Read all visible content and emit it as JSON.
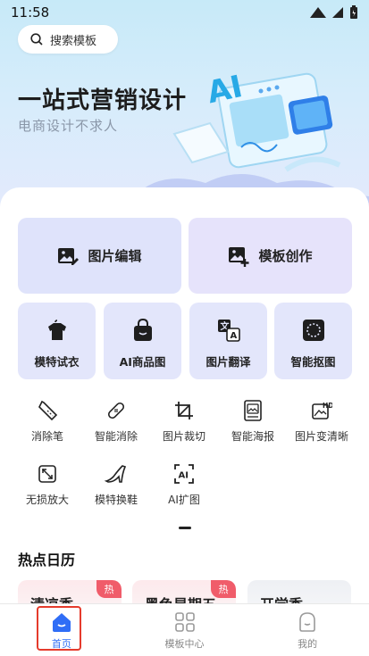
{
  "status": {
    "time": "11:58"
  },
  "search": {
    "placeholder": "搜索模板"
  },
  "hero": {
    "title": "一站式营销设计",
    "subtitle": "电商设计不求人"
  },
  "primary_actions": [
    {
      "label": "图片编辑",
      "icon": "image-edit-icon"
    },
    {
      "label": "模板创作",
      "icon": "template-create-icon"
    }
  ],
  "feature_cards": [
    {
      "label": "模特试衣",
      "icon": "tshirt-icon"
    },
    {
      "label": "AI商品图",
      "icon": "shopping-bag-icon"
    },
    {
      "label": "图片翻译",
      "icon": "translate-icon"
    },
    {
      "label": "智能抠图",
      "icon": "cutout-icon"
    }
  ],
  "tools": [
    {
      "label": "消除笔",
      "icon": "eraser-pen-icon"
    },
    {
      "label": "智能消除",
      "icon": "bandage-icon"
    },
    {
      "label": "图片裁切",
      "icon": "crop-icon"
    },
    {
      "label": "智能海报",
      "icon": "poster-icon"
    },
    {
      "label": "图片变清晰",
      "icon": "hd-image-icon"
    },
    {
      "label": "无损放大",
      "icon": "upscale-icon"
    },
    {
      "label": "模特换鞋",
      "icon": "high-heel-icon"
    },
    {
      "label": "AI扩图",
      "icon": "ai-expand-icon"
    }
  ],
  "calendar": {
    "title": "热点日历",
    "cards": [
      {
        "name": "清凉季",
        "badge": "热"
      },
      {
        "name": "黑色星期五",
        "badge": "热"
      },
      {
        "name": "开学季",
        "badge": ""
      }
    ]
  },
  "tabbar": [
    {
      "label": "首页",
      "icon": "home-icon",
      "active": true
    },
    {
      "label": "模板中心",
      "icon": "grid-icon",
      "active": false
    },
    {
      "label": "我的",
      "icon": "profile-icon",
      "active": false
    }
  ],
  "colors": {
    "accent": "#2f6df6",
    "hot_badge": "#f05c6a",
    "highlight": "#e53b2c"
  }
}
